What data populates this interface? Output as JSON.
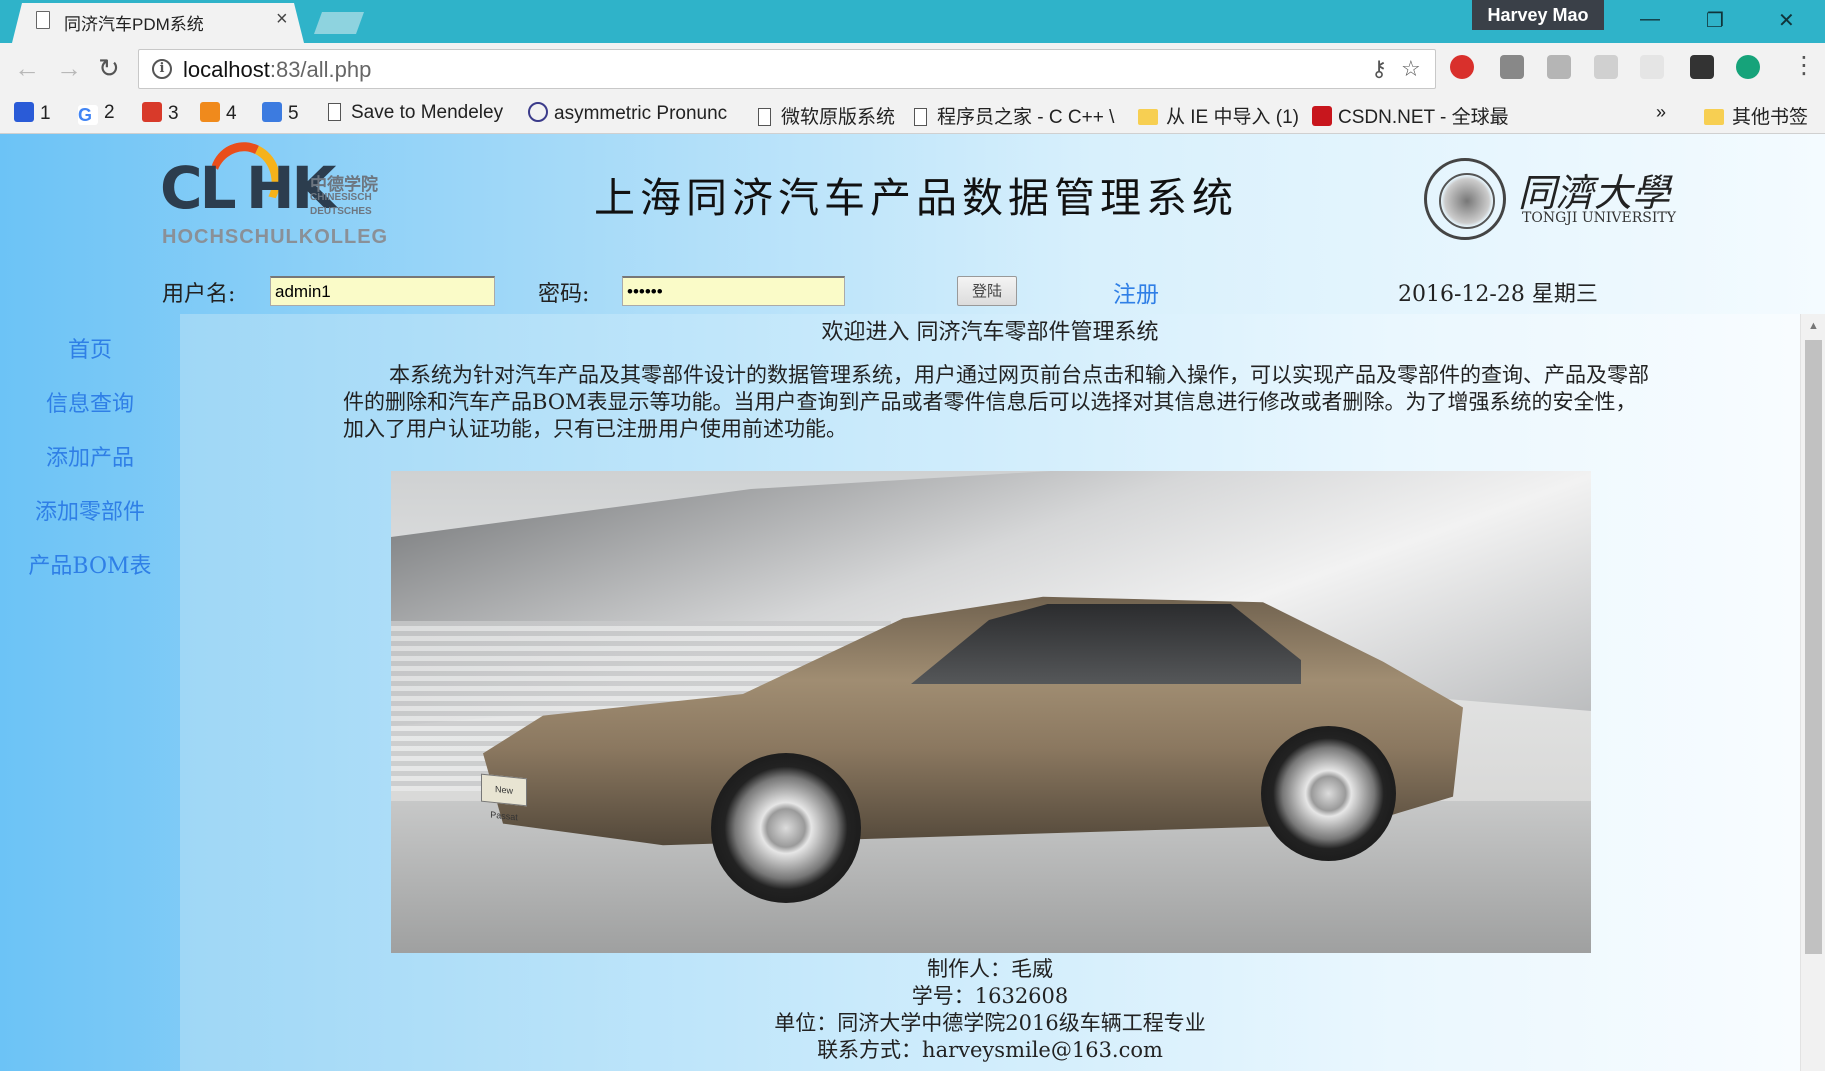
{
  "browser": {
    "tab_title": "同济汽车PDM系统",
    "tab_close": "×",
    "user_name": "Harvey Mao",
    "window_controls": {
      "minimize": "—",
      "restore": "❐",
      "close": "✕"
    },
    "nav": {
      "back": "←",
      "forward": "→",
      "reload": "↻"
    },
    "url_host": "localhost",
    "url_path": ":83/all.php",
    "bookmarks": [
      {
        "label": "1",
        "icon": "paw-icon",
        "color": "#2a5bd7"
      },
      {
        "label": "2",
        "icon": "google-icon",
        "color": "#4285f4"
      },
      {
        "label": "3",
        "icon": "seal-icon",
        "color": "#d83a2a"
      },
      {
        "label": "4",
        "icon": "fish-icon",
        "color": "#f08a1c"
      },
      {
        "label": "5",
        "icon": "puzzle-icon",
        "color": "#3c7be0"
      },
      {
        "label": "Save to Mendeley",
        "icon": "page-icon"
      },
      {
        "label": "asymmetric Pronunc",
        "icon": "c-icon"
      },
      {
        "label": "微软原版系统",
        "icon": "page-icon"
      },
      {
        "label": "程序员之家 - C C++ \\",
        "icon": "page-icon"
      },
      {
        "label": "从 IE 中导入 (1)",
        "icon": "folder-icon"
      },
      {
        "label": "CSDN.NET - 全球最",
        "icon": "csdn-icon",
        "color": "#c8161d"
      }
    ],
    "bookmarks_overflow": "»",
    "other_bookmarks": "其他书签"
  },
  "header": {
    "clhk_letters_a": "CL",
    "clhk_letters_b": "HK",
    "clhk_cn": "中德学院",
    "clhk_de1": "CHINESISCH",
    "clhk_de2": "DEUTSCHES",
    "clhk_hs": "HOCHSCHULKOLLEG",
    "title": "上海同济汽车产品数据管理系统",
    "tongji_cn": "同濟大學",
    "tongji_en": "TONGJI UNIVERSITY"
  },
  "login": {
    "username_label": "用户名:",
    "username_value": "admin1",
    "password_label": "密码:",
    "password_value": "••••••",
    "login_button": "登陆",
    "register_link": "注册",
    "date": "2016-12-28 星期三"
  },
  "sidebar": {
    "items": [
      {
        "label": "首页"
      },
      {
        "label": "信息查询"
      },
      {
        "label": "添加产品"
      },
      {
        "label": "添加零部件"
      },
      {
        "label": "产品BOM表"
      }
    ]
  },
  "main": {
    "welcome": "欢迎进入 同济汽车零部件管理系统",
    "intro": "本系统为针对汽车产品及其零部件设计的数据管理系统，用户通过网页前台点击和输入操作，可以实现产品及零部件的查询、产品及零部件的删除和汽车产品BOM表显示等功能。当用户查询到产品或者零件信息后可以选择对其信息进行修改或者删除。为了增强系统的安全性，加入了用户认证功能，只有已注册用户使用前述功能。",
    "plate_text": "New Passat",
    "credits": {
      "author": "制作人：毛威",
      "student_id": "学号：1632608",
      "unit": "单位：同济大学中德学院2016级车辆工程专业",
      "contact": "联系方式：harveysmile@163.com"
    }
  }
}
